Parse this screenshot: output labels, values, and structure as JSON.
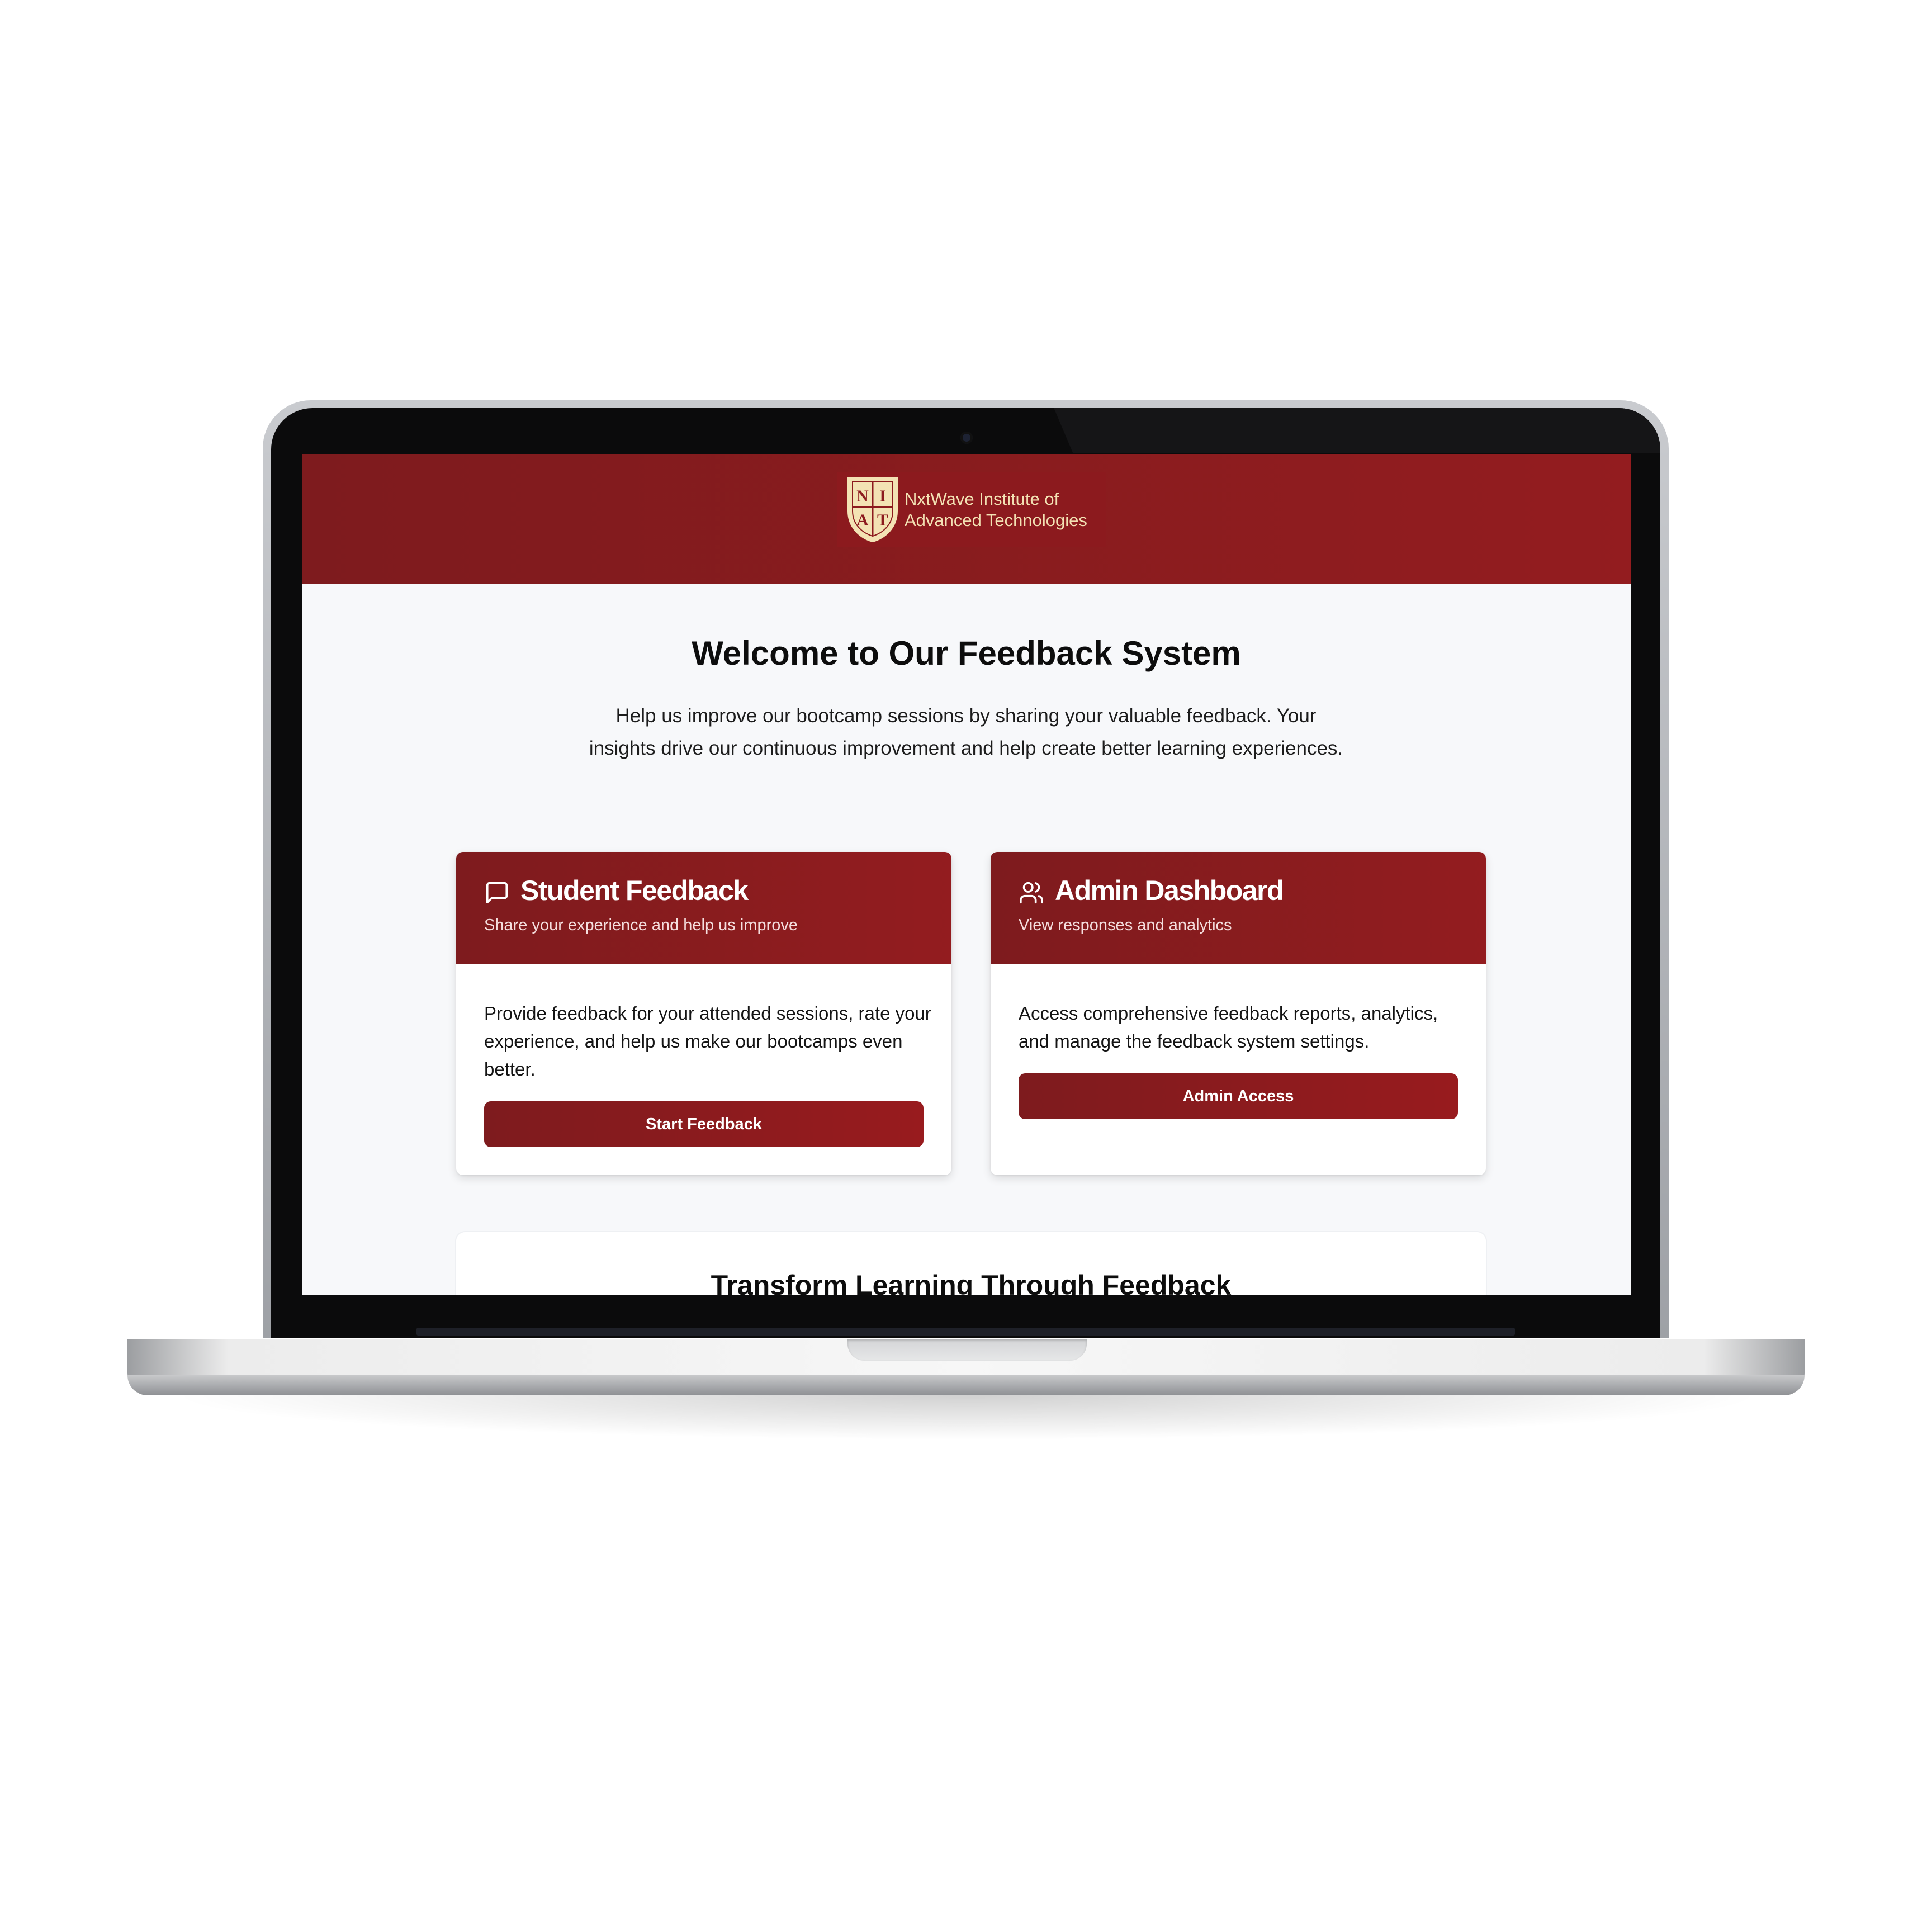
{
  "header": {
    "logo_letters": [
      "N",
      "I",
      "A",
      "T"
    ],
    "logo_line1": "NxtWave Institute of",
    "logo_line2": "Advanced Technologies"
  },
  "hero": {
    "title": "Welcome to Our Feedback System",
    "subtitle": "Help us improve our bootcamp sessions by sharing your valuable feedback. Your insights drive our continuous improvement and help create better learning experiences."
  },
  "cards": [
    {
      "icon": "message-square-icon",
      "title": "Student Feedback",
      "subtitle": "Share your experience and help us improve",
      "body": "Provide feedback for your attended sessions, rate your experience, and help us make our bootcamps even better.",
      "button": "Start Feedback"
    },
    {
      "icon": "users-icon",
      "title": "Admin Dashboard",
      "subtitle": "View responses and analytics",
      "body": "Access comprehensive feedback reports, analytics, and manage the feedback system settings.",
      "button": "Admin Access"
    }
  ],
  "section": {
    "title": "Transform Learning Through Feedback"
  },
  "colors": {
    "brand_red": "#8c1a1e",
    "logo_gold": "#f3e2b4",
    "page_bg": "#f7f8fa"
  }
}
